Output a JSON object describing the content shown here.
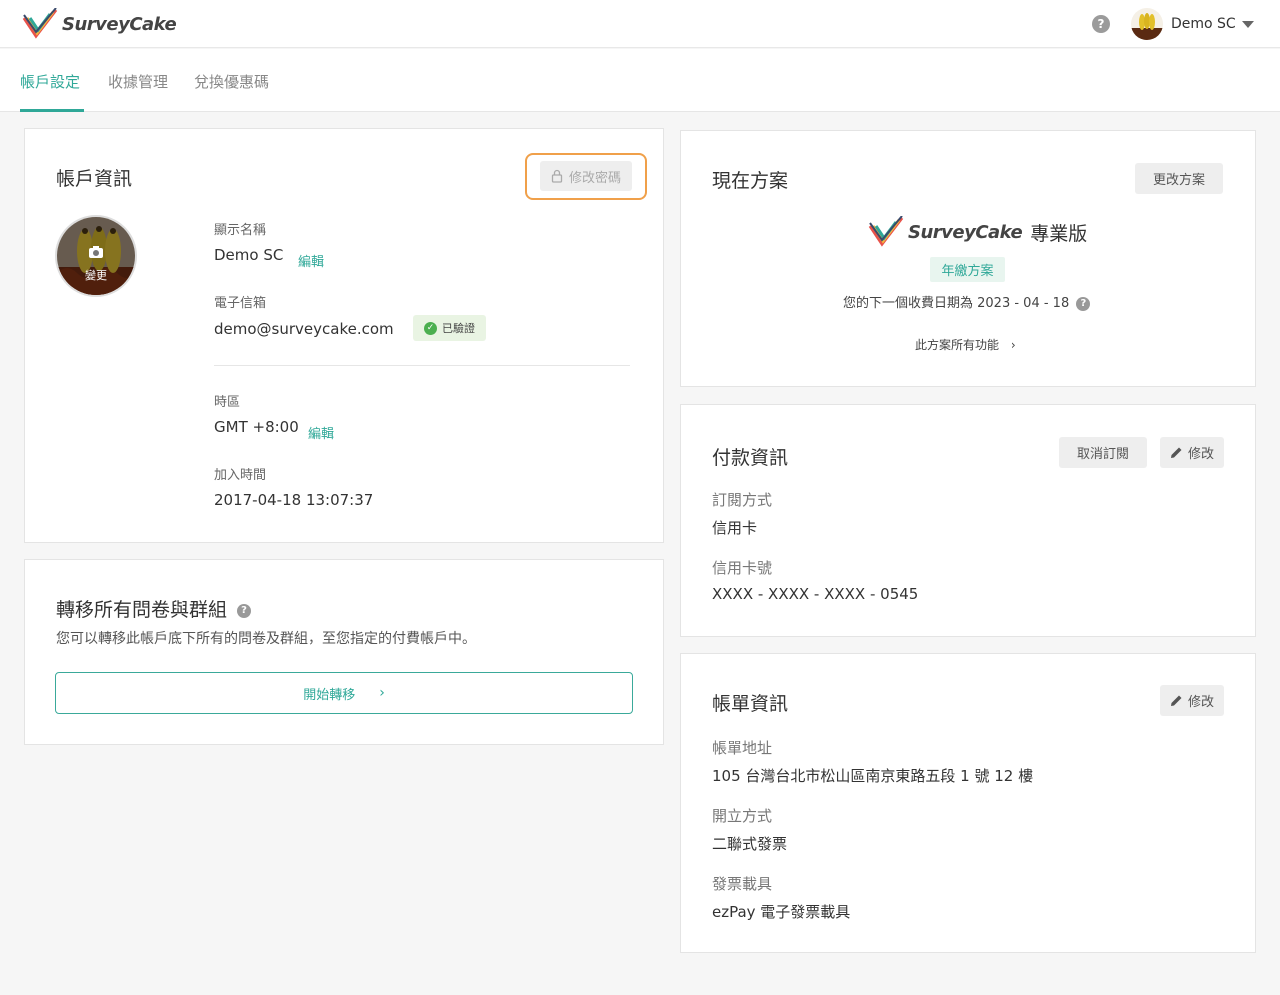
{
  "header": {
    "logo_text": "SurveyCake",
    "help": "?",
    "user_name": "Demo SC"
  },
  "tabs": [
    {
      "label": "帳戶設定"
    },
    {
      "label": "收據管理"
    },
    {
      "label": "兌換優惠碼"
    }
  ],
  "account": {
    "title": "帳戶資訊",
    "change_password": "修改密碼",
    "avatar_change": "變更",
    "display_name_label": "顯示名稱",
    "display_name": "Demo SC",
    "edit": "編輯",
    "email_label": "電子信箱",
    "email": "demo@surveycake.com",
    "verified": "已驗證",
    "timezone_label": "時區",
    "timezone": "GMT +8:00",
    "timezone_edit": "編輯",
    "joined_label": "加入時間",
    "joined": "2017-04-18 13:07:37"
  },
  "transfer": {
    "title": "轉移所有問卷與群組",
    "help": "?",
    "desc": "您可以轉移此帳戶底下所有的問卷及群組，至您指定的付費帳戶中。",
    "button": "開始轉移",
    "button_arrow": "›"
  },
  "plan": {
    "title": "現在方案",
    "change": "更改方案",
    "logo_text": "SurveyCake",
    "edition": "專業版",
    "badge": "年繳方案",
    "next_billing": "您的下一個收費日期為 2023 - 04 - 18",
    "help": "?",
    "features": "此方案所有功能",
    "features_arrow": "›"
  },
  "payment": {
    "title": "付款資訊",
    "cancel": "取消訂閱",
    "edit": "修改",
    "method_label": "訂閱方式",
    "method": "信用卡",
    "card_label": "信用卡號",
    "card": "XXXX - XXXX - XXXX - 0545"
  },
  "billing": {
    "title": "帳單資訊",
    "edit": "修改",
    "address_label": "帳單地址",
    "address": "105 台灣台北市松山區南京東路五段 1 號 12 樓",
    "invoice_type_label": "開立方式",
    "invoice_type": "二聯式發票",
    "carrier_label": "發票載具",
    "carrier": "ezPay 電子發票載具"
  },
  "colors": {
    "accent": "#2fa898",
    "highlight": "#f0a04a",
    "verified_bg": "#e9f4e3"
  }
}
